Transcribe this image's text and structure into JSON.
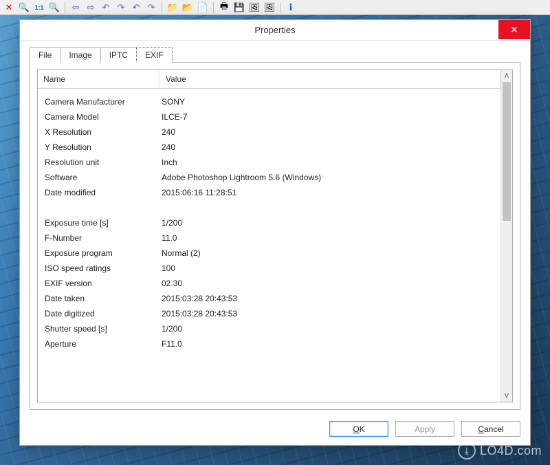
{
  "dialog": {
    "title": "Properties",
    "tabs": [
      "File",
      "Image",
      "IPTC",
      "EXIF"
    ],
    "active_tab": 3,
    "columns": {
      "name": "Name",
      "value": "Value"
    },
    "rows": [
      {
        "name": "Camera Manufacturer",
        "value": "SONY"
      },
      {
        "name": "Camera Model",
        "value": "ILCE-7"
      },
      {
        "name": "X Resolution",
        "value": "240"
      },
      {
        "name": "Y Resolution",
        "value": "240"
      },
      {
        "name": "Resolution unit",
        "value": "Inch"
      },
      {
        "name": "Software",
        "value": "Adobe Photoshop Lightroom 5.6 (Windows)"
      },
      {
        "name": "Date modified",
        "value": "2015:06:16 11:28:51"
      },
      {
        "spacer": true
      },
      {
        "name": "Exposure time [s]",
        "value": "1/200"
      },
      {
        "name": "F-Number",
        "value": "11.0"
      },
      {
        "name": "Exposure program",
        "value": "Normal (2)"
      },
      {
        "name": "ISO speed ratings",
        "value": "100"
      },
      {
        "name": "EXIF version",
        "value": "02.30"
      },
      {
        "name": "Date taken",
        "value": "2015:03:28 20:43:53"
      },
      {
        "name": "Date digitized",
        "value": "2015:03:28 20:43:53"
      },
      {
        "name": "Shutter speed [s]",
        "value": "1/200"
      },
      {
        "name": "Aperture",
        "value": "F11.0"
      }
    ],
    "buttons": {
      "ok": "OK",
      "apply": "Apply",
      "cancel": "Cancel"
    }
  },
  "watermark": "LO4D.com",
  "toolbar_icons": {
    "close_red": "✕",
    "zoom": "🔍",
    "ratio": "1:1",
    "arrow_left": "⇦",
    "arrow_right": "⇨",
    "rotate_l": "↶",
    "rotate_r": "↷",
    "folder1": "📁",
    "folder2": "📂",
    "doc": "📄",
    "print": "🖶",
    "save": "💾",
    "img": "🖼",
    "info": "ℹ"
  }
}
